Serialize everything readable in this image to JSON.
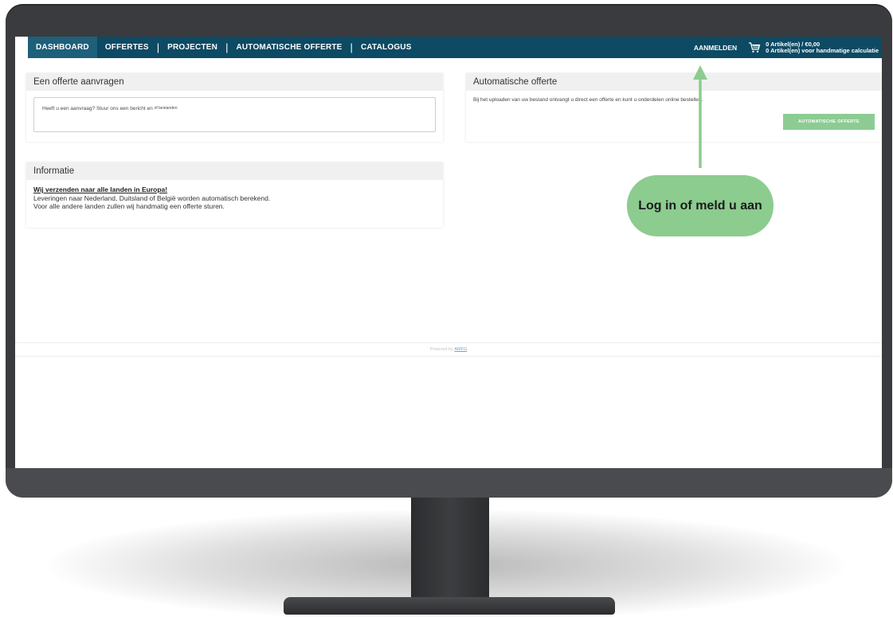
{
  "nav": {
    "items": [
      {
        "label": "DASHBOARD",
        "active": true
      },
      {
        "label": "OFFERTES",
        "active": false
      },
      {
        "label": "PROJECTEN",
        "active": false
      },
      {
        "label": "AUTOMATISCHE OFFERTE",
        "active": false
      },
      {
        "label": "CATALOGUS",
        "active": false
      }
    ],
    "login_label": "AANMELDEN",
    "cart_line1": "0 Artikel(en) / €0,00",
    "cart_line2": "0 Artikel(en) voor handmatige calculatie"
  },
  "request_panel": {
    "title": "Een offerte aanvragen",
    "text": "Heeft u een aanvraag? Stuur ons een bericht en",
    "text_small": "of bestanden"
  },
  "auto_panel": {
    "title": "Automatische offerte",
    "text": "Bij het uploaden van uw bestand ontvangt u direct een offerte en kunt u onderdelen online bestellen.",
    "button_label": "AUTOMATISCHE OFFERTE"
  },
  "info_panel": {
    "title": "Informatie",
    "link_text": "Wij verzenden naar alle landen in Europa!",
    "line1": "Leveringen naar Nederland, Duitsland of België worden automatisch berekend.",
    "line2": "Voor alle andere landen zullen wij handmatig een offerte sturen."
  },
  "footer": {
    "prefix": "Powered by",
    "brand": "AMFG"
  },
  "annotation": {
    "text": "Log in of meld u aan"
  },
  "colors": {
    "navbar": "#0d4a63",
    "accent_green": "#8ccc8f",
    "monitor": "#3a3b3e"
  }
}
